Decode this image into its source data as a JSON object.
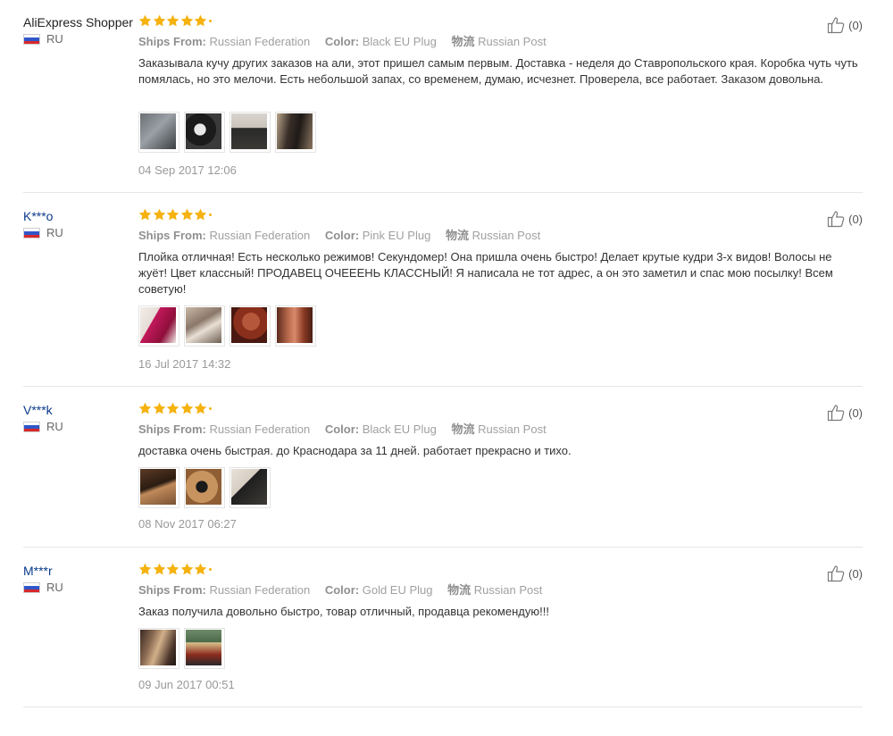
{
  "ratings_fraction": 1.0,
  "labels": {
    "ships_from": "Ships From:",
    "color": "Color:",
    "logistics": "物流"
  },
  "reviews": [
    {
      "user": "AliExpress Shopper",
      "country": "RU",
      "stars": 5,
      "ships_from": "Russian Federation",
      "color": "Black EU Plug",
      "logistics": "Russian Post",
      "text": "Заказывала кучу других заказов на али, этот пришел самым первым. Доставка - неделя до Ставропольского края. Коробка чуть чуть помялась, но это мелочи. Есть небольшой запах, со временем, думаю, исчезнет. Проверела, все работает. Заказом довольна.",
      "date": "04 Sep 2017 12:06",
      "helpful_count": "(0)",
      "photos": 4
    },
    {
      "user": "K***o",
      "country": "RU",
      "stars": 5,
      "ships_from": "Russian Federation",
      "color": "Pink EU Plug",
      "logistics": "Russian Post",
      "text": "Плойка отличная! Есть несколько режимов! Секундомер! Она пришла очень быстро! Делает крутые кудри 3-х видов! Волосы не жуёт! Цвет классный! ПРОДАВЕЦ ОЧЕЕЕНЬ КЛАССНЫЙ! Я написала не тот адрес, а он это заметил и спас мою посылку! Всем советую!",
      "date": "16 Jul 2017 14:32",
      "helpful_count": "(0)",
      "photos": 4
    },
    {
      "user": "V***k",
      "country": "RU",
      "stars": 5,
      "ships_from": "Russian Federation",
      "color": "Black EU Plug",
      "logistics": "Russian Post",
      "text": "доставка очень быстрая. до Краснодара за 11 дней. работает прекрасно и тихо.",
      "date": "08 Nov 2017 06:27",
      "helpful_count": "(0)",
      "photos": 3
    },
    {
      "user": "M***r",
      "country": "RU",
      "stars": 5,
      "ships_from": "Russian Federation",
      "color": "Gold EU Plug",
      "logistics": "Russian Post",
      "text": "Заказ получила довольно быстро, товар отличный, продавца рекомендую!!!",
      "date": "09 Jun 2017 00:51",
      "helpful_count": "(0)",
      "photos": 2
    }
  ],
  "colors": {
    "username": "#0a3a8a",
    "star": "#f5b210",
    "meta_text": "#a0a0a0",
    "body_text": "#333333",
    "date_text": "#999999",
    "separator": "#e6e6e6"
  },
  "icons": {
    "helpful": "thumbs-up-icon",
    "country": "russia-flag-icon",
    "rating": "star-icon"
  }
}
